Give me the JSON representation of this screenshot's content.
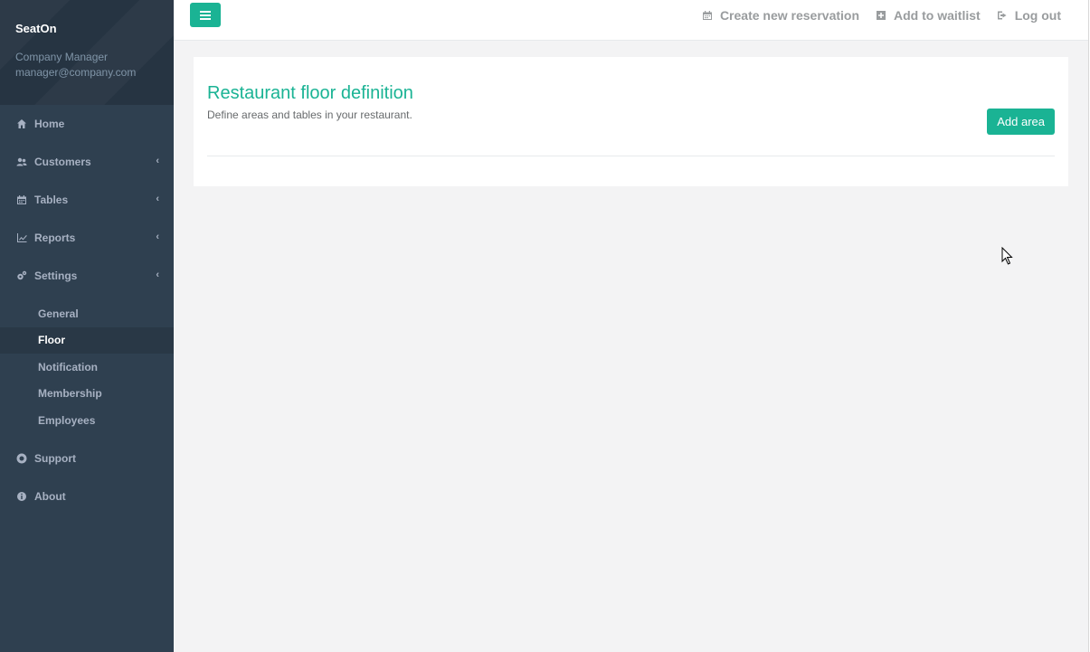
{
  "sidebar": {
    "brand": "SeatOn",
    "role": "Company Manager",
    "email": "manager@company.com",
    "items": [
      {
        "label": "Home",
        "icon": "home-icon",
        "has_children": false
      },
      {
        "label": "Customers",
        "icon": "users-icon",
        "has_children": true
      },
      {
        "label": "Tables",
        "icon": "calendar-icon",
        "has_children": true
      },
      {
        "label": "Reports",
        "icon": "line-chart-icon",
        "has_children": true
      },
      {
        "label": "Settings",
        "icon": "cogs-icon",
        "has_children": true
      }
    ],
    "settings_sub": [
      "General",
      "Floor",
      "Notification",
      "Membership",
      "Employees"
    ],
    "active_sub": "Floor",
    "bottom_items": [
      {
        "label": "Support",
        "icon": "life-ring-icon"
      },
      {
        "label": "About",
        "icon": "info-icon"
      }
    ],
    "chevron": "‹"
  },
  "topbar": {
    "links": [
      {
        "label": "Create new reservation",
        "icon": "calendar-icon"
      },
      {
        "label": "Add to waitlist",
        "icon": "plus-square-icon"
      },
      {
        "label": "Log out",
        "icon": "sign-out-icon"
      }
    ]
  },
  "main": {
    "title": "Restaurant floor definition",
    "subtitle": "Define areas and tables in your restaurant.",
    "add_button": "Add area"
  },
  "colors": {
    "accent": "#1ab394",
    "sidebar_bg": "#2f4050",
    "page_bg": "#f3f3f4"
  }
}
